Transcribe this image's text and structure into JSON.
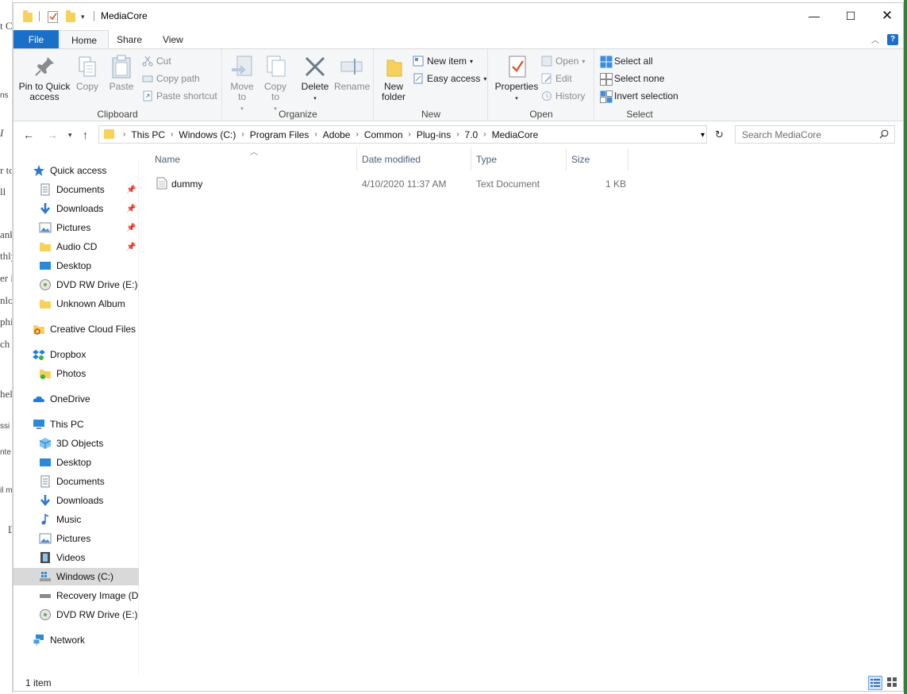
{
  "window": {
    "title": "MediaCore"
  },
  "background_fragments": [
    "t C",
    "ns",
    "I",
    "r to",
    "ll",
    "ank",
    "thly",
    "er i",
    "nlo",
    "phi",
    "ch",
    "hel",
    "ssi",
    "nte",
    "il m",
    "D"
  ],
  "ribbon": {
    "tabs": {
      "file": "File",
      "home": "Home",
      "share": "Share",
      "view": "View"
    },
    "clipboard": {
      "label": "Clipboard",
      "pin": "Pin to Quick access",
      "copy": "Copy",
      "paste": "Paste",
      "cut": "Cut",
      "copy_path": "Copy path",
      "paste_shortcut": "Paste shortcut"
    },
    "organize": {
      "label": "Organize",
      "move_to": "Move to",
      "copy_to": "Copy to",
      "delete": "Delete",
      "rename": "Rename"
    },
    "new": {
      "label": "New",
      "new_folder": "New folder",
      "new_item": "New item",
      "easy_access": "Easy access"
    },
    "open": {
      "label": "Open",
      "properties": "Properties",
      "open": "Open",
      "edit": "Edit",
      "history": "History"
    },
    "select": {
      "label": "Select",
      "select_all": "Select all",
      "select_none": "Select none",
      "invert_selection": "Invert selection"
    }
  },
  "address": {
    "crumbs": [
      "This PC",
      "Windows (C:)",
      "Program Files",
      "Adobe",
      "Common",
      "Plug-ins",
      "7.0",
      "MediaCore"
    ],
    "search_placeholder": "Search MediaCore"
  },
  "nav": {
    "quick_access": "Quick access",
    "qa_items": [
      "Documents",
      "Downloads",
      "Pictures",
      "Audio CD",
      "Desktop",
      "DVD RW Drive (E:) S",
      "Unknown Album"
    ],
    "creative_cloud": "Creative Cloud Files",
    "dropbox": "Dropbox",
    "photos": "Photos",
    "onedrive": "OneDrive",
    "this_pc": "This PC",
    "pc_items": [
      "3D Objects",
      "Desktop",
      "Documents",
      "Downloads",
      "Music",
      "Pictures",
      "Videos",
      "Windows (C:)",
      "Recovery Image (D:",
      "DVD RW Drive (E:) S"
    ],
    "network": "Network"
  },
  "columns": {
    "name": "Name",
    "date": "Date modified",
    "type": "Type",
    "size": "Size"
  },
  "files": [
    {
      "name": "dummy",
      "date": "4/10/2020 11:37 AM",
      "type": "Text Document",
      "size": "1 KB"
    }
  ],
  "status": {
    "count": "1 item"
  }
}
